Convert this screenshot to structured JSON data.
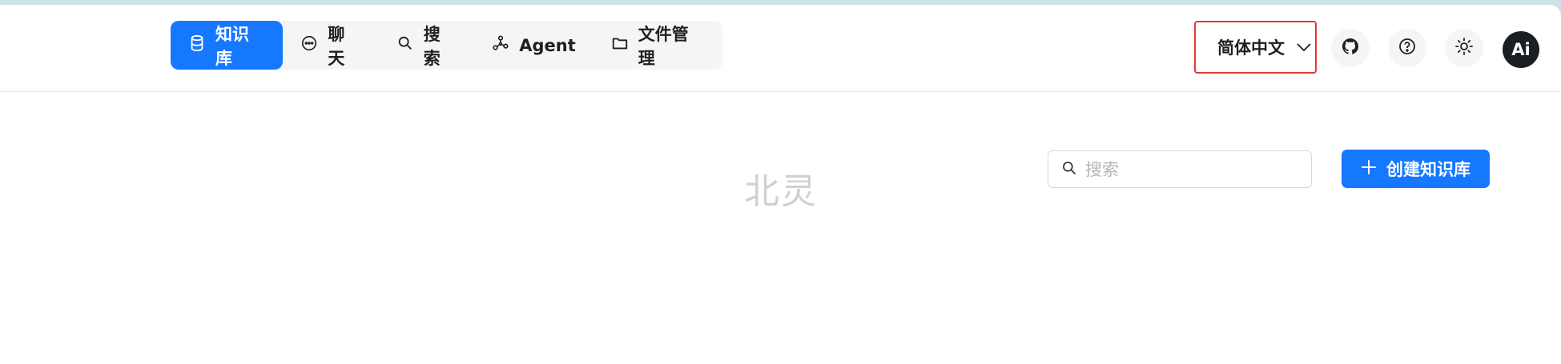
{
  "nav": {
    "items": [
      {
        "label": "知识库",
        "icon": "database-icon",
        "active": true
      },
      {
        "label": "聊天",
        "icon": "chat-bubble-icon",
        "active": false
      },
      {
        "label": "搜索",
        "icon": "search-icon",
        "active": false
      },
      {
        "label": "Agent",
        "icon": "agent-graph-icon",
        "active": false
      },
      {
        "label": "文件管理",
        "icon": "folder-icon",
        "active": false
      }
    ]
  },
  "header": {
    "language": "简体中文",
    "github_icon": "github-icon",
    "help_icon": "help-circle-icon",
    "theme_icon": "sun-icon",
    "avatar_text": "Ai"
  },
  "main": {
    "title": "北灵",
    "search_placeholder": "搜索",
    "create_button": "创建知识库"
  },
  "colors": {
    "accent": "#1677ff",
    "highlight_border": "#e53935"
  }
}
